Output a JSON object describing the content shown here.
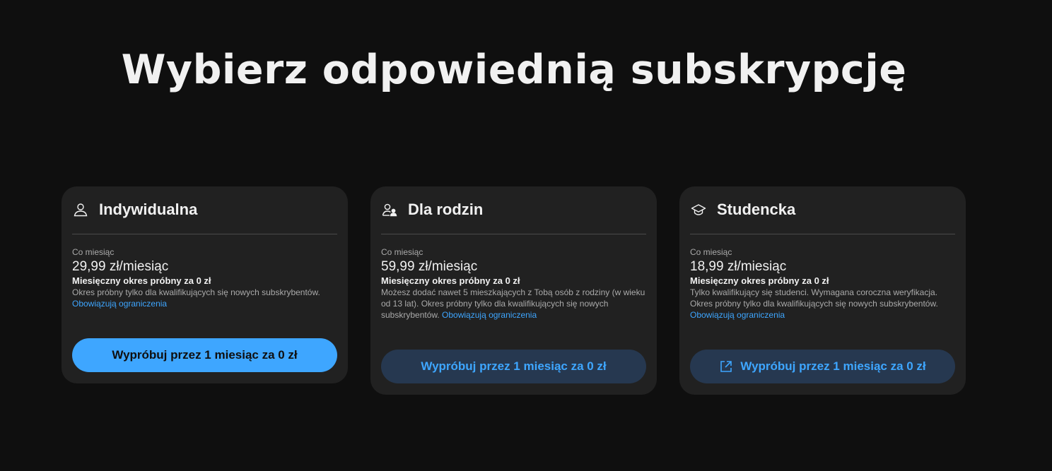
{
  "headline": "Wybierz odpowiednią subskrypcję",
  "plans": [
    {
      "icon": "person-icon",
      "title": "Indywidualna",
      "period": "Co miesiąc",
      "price": "29,99 zł/miesiąc",
      "trial": "Miesięczny okres próbny za 0 zł",
      "description": "Okres próbny tylko dla kwalifikujących się nowych subskrybentów. ",
      "restrictions_link": "Obowiązują ograniczenia",
      "cta_label": "Wypróbuj przez 1 miesiąc za 0 zł",
      "cta_style": "primary"
    },
    {
      "icon": "family-icon",
      "title": "Dla rodzin",
      "period": "Co miesiąc",
      "price": "59,99 zł/miesiąc",
      "trial": "Miesięczny okres próbny za 0 zł",
      "description": "Możesz dodać nawet 5 mieszkających z Tobą osób z rodziny (w wieku od 13 lat). Okres próbny tylko dla kwalifikujących się nowych subskrybentów. ",
      "restrictions_link": "Obowiązują ograniczenia",
      "cta_label": "Wypróbuj przez 1 miesiąc za 0 zł",
      "cta_style": "secondary"
    },
    {
      "icon": "graduation-cap-icon",
      "title": "Studencka",
      "period": "Co miesiąc",
      "price": "18,99 zł/miesiąc",
      "trial": "Miesięczny okres próbny za 0 zł",
      "description": "Tylko kwalifikujący się studenci. Wymagana coroczna weryfikacja. Okres próbny tylko dla kwalifikujących się nowych subskrybentów. ",
      "restrictions_link": "Obowiązują ograniczenia",
      "cta_label": "Wypróbuj przez 1 miesiąc za 0 zł",
      "cta_style": "secondary",
      "cta_icon": "open-in-new-icon"
    }
  ],
  "colors": {
    "background": "#0f0f0f",
    "card": "#212121",
    "accent": "#3ea6ff",
    "secondary_button": "#263850",
    "muted_text": "#aaaaaa"
  }
}
